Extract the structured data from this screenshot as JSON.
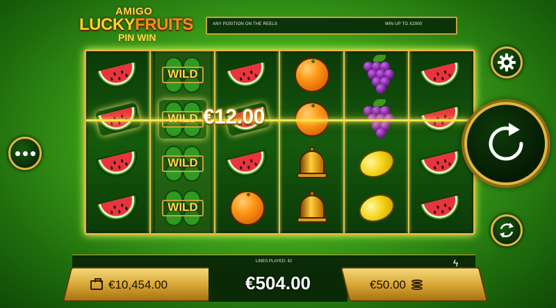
{
  "logo": {
    "line1": "AMIGO",
    "line2a": "LUCKY",
    "line2b": "FRUITS",
    "line3": "PIN WIN"
  },
  "info_bar": {
    "left_text": "ANY POSITION ON THE REELS",
    "right_text": "WIN UP TO X2000"
  },
  "reels": {
    "columns": [
      [
        "watermelon",
        "watermelon",
        "watermelon",
        "watermelon"
      ],
      [
        "wild",
        "wild",
        "wild",
        "wild"
      ],
      [
        "watermelon",
        "watermelon",
        "watermelon",
        "orange"
      ],
      [
        "orange",
        "orange",
        "bell",
        "bell"
      ],
      [
        "grapes",
        "grapes",
        "lemon",
        "lemon"
      ],
      [
        "watermelon",
        "watermelon",
        "watermelon",
        "watermelon"
      ]
    ],
    "wild_label": "WILD",
    "win_amount": "€12.00"
  },
  "controls": {
    "menu_icon": "more-dots-icon",
    "settings_icon": "gear-icon",
    "spin_icon": "spin-arrow-icon",
    "autoplay_icon": "autoplay-cycle-icon"
  },
  "bottom_bar": {
    "lines_played": "LINES PLAYED: 42",
    "turbo_icon": "lightning-icon",
    "balance": "€10,454.00",
    "total_win": "€504.00",
    "bet": "€50.00"
  },
  "colors": {
    "gold": "#e0b540",
    "green_bg": "#3fa51a",
    "dark_panel": "#0b3308"
  }
}
